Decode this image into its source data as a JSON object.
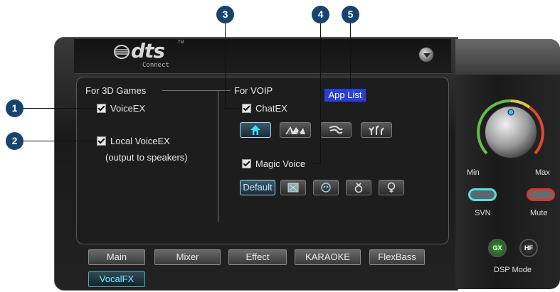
{
  "header": {
    "brand": "dts",
    "tm": "TM",
    "subtitle": "Connect"
  },
  "left": {
    "section_title": "For 3D Games",
    "voiceex_label": "VoiceEX",
    "local_voiceex_label": "Local VoiceEX",
    "local_voiceex_note": "(output to speakers)"
  },
  "voip": {
    "section_title": "For VOIP",
    "app_list_label": "App List",
    "chatex_label": "ChatEX",
    "magic_voice_label": "Magic Voice",
    "default_label": "Default"
  },
  "tabs": [
    "Main",
    "Mixer",
    "Effect",
    "KARAOKE",
    "FlexBass",
    "VocalFX"
  ],
  "right": {
    "min_label": "Min",
    "max_label": "Max",
    "svn_label": "SVN",
    "mute_label": "Mute",
    "dsp_label": "DSP Mode",
    "gx_label": "GX",
    "hf_label": "HF"
  },
  "callouts": [
    "1",
    "2",
    "3",
    "4",
    "5"
  ],
  "colors": {
    "accent_blue": "#2a3fd8",
    "callout": "#16446e",
    "svn_glow": "#4fe0e8",
    "mute_glow": "#e23030"
  }
}
